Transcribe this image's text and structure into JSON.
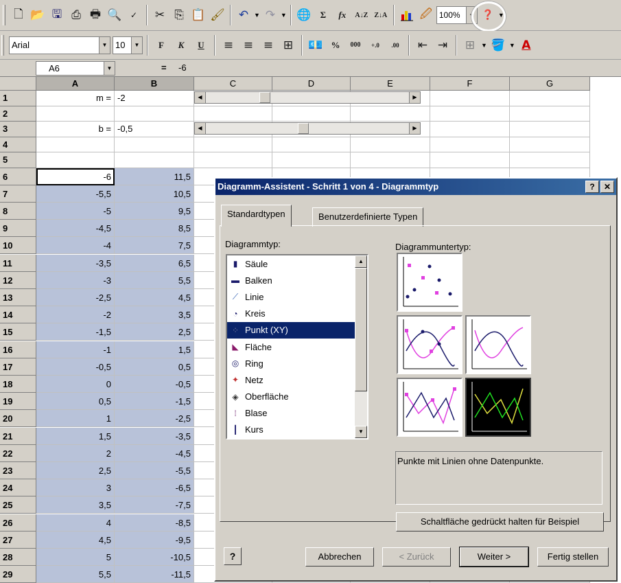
{
  "toolbar": {
    "zoom": "100%",
    "icons": [
      "new-icon",
      "open-icon",
      "save-icon",
      "print-setup-icon",
      "print-icon",
      "print-preview-icon",
      "spelling-icon",
      "cut-icon",
      "copy-icon",
      "paste-icon",
      "format-painter-icon",
      "undo-icon",
      "redo-icon",
      "hyperlink-icon",
      "autosum-icon",
      "function-icon",
      "sort-ascending-icon",
      "sort-descending-icon",
      "chart-wizard-icon",
      "drawing-icon",
      "help-icon"
    ]
  },
  "format": {
    "font": "Arial",
    "size": "10",
    "bold": "F",
    "italic": "K",
    "underline": "U",
    "currency": "%",
    "thousands": "000"
  },
  "namebox": {
    "cell": "A6",
    "formula_eq": "=",
    "formula_value": "-6"
  },
  "columns": [
    "A",
    "B",
    "C",
    "D",
    "E",
    "F",
    "G"
  ],
  "rows": [
    {
      "n": "1",
      "a": "m =",
      "b": "-2"
    },
    {
      "n": "2",
      "a": "",
      "b": ""
    },
    {
      "n": "3",
      "a": "b =",
      "b": "-0,5"
    },
    {
      "n": "4",
      "a": "",
      "b": ""
    },
    {
      "n": "5",
      "a": "",
      "b": ""
    },
    {
      "n": "6",
      "a": "-6",
      "b": "11,5"
    },
    {
      "n": "7",
      "a": "-5,5",
      "b": "10,5"
    },
    {
      "n": "8",
      "a": "-5",
      "b": "9,5"
    },
    {
      "n": "9",
      "a": "-4,5",
      "b": "8,5"
    },
    {
      "n": "10",
      "a": "-4",
      "b": "7,5"
    },
    {
      "n": "11",
      "a": "-3,5",
      "b": "6,5"
    },
    {
      "n": "12",
      "a": "-3",
      "b": "5,5"
    },
    {
      "n": "13",
      "a": "-2,5",
      "b": "4,5"
    },
    {
      "n": "14",
      "a": "-2",
      "b": "3,5"
    },
    {
      "n": "15",
      "a": "-1,5",
      "b": "2,5"
    },
    {
      "n": "16",
      "a": "-1",
      "b": "1,5"
    },
    {
      "n": "17",
      "a": "-0,5",
      "b": "0,5"
    },
    {
      "n": "18",
      "a": "0",
      "b": "-0,5"
    },
    {
      "n": "19",
      "a": "0,5",
      "b": "-1,5"
    },
    {
      "n": "20",
      "a": "1",
      "b": "-2,5"
    },
    {
      "n": "21",
      "a": "1,5",
      "b": "-3,5"
    },
    {
      "n": "22",
      "a": "2",
      "b": "-4,5"
    },
    {
      "n": "23",
      "a": "2,5",
      "b": "-5,5"
    },
    {
      "n": "24",
      "a": "3",
      "b": "-6,5"
    },
    {
      "n": "25",
      "a": "3,5",
      "b": "-7,5"
    },
    {
      "n": "26",
      "a": "4",
      "b": "-8,5"
    },
    {
      "n": "27",
      "a": "4,5",
      "b": "-9,5"
    },
    {
      "n": "28",
      "a": "5",
      "b": "-10,5"
    },
    {
      "n": "29",
      "a": "5,5",
      "b": "-11,5"
    }
  ],
  "dialog": {
    "title": "Diagramm-Assistent - Schritt 1 von 4 - Diagrammtyp",
    "tabs": [
      "Standardtypen",
      "Benutzerdefinierte Typen"
    ],
    "charttype_label": "Diagrammtyp:",
    "subtype_label": "Diagrammuntertyp:",
    "types": [
      "Säule",
      "Balken",
      "Linie",
      "Kreis",
      "Punkt (XY)",
      "Fläche",
      "Ring",
      "Netz",
      "Oberfläche",
      "Blase",
      "Kurs"
    ],
    "selected_type": "Punkt (XY)",
    "description": "Punkte mit Linien ohne Datenpunkte.",
    "preview_button": "Schaltfläche gedrückt halten für Beispiel",
    "cancel": "Abbrechen",
    "back": "< Zurück",
    "next": "Weiter >",
    "finish": "Fertig stellen"
  }
}
